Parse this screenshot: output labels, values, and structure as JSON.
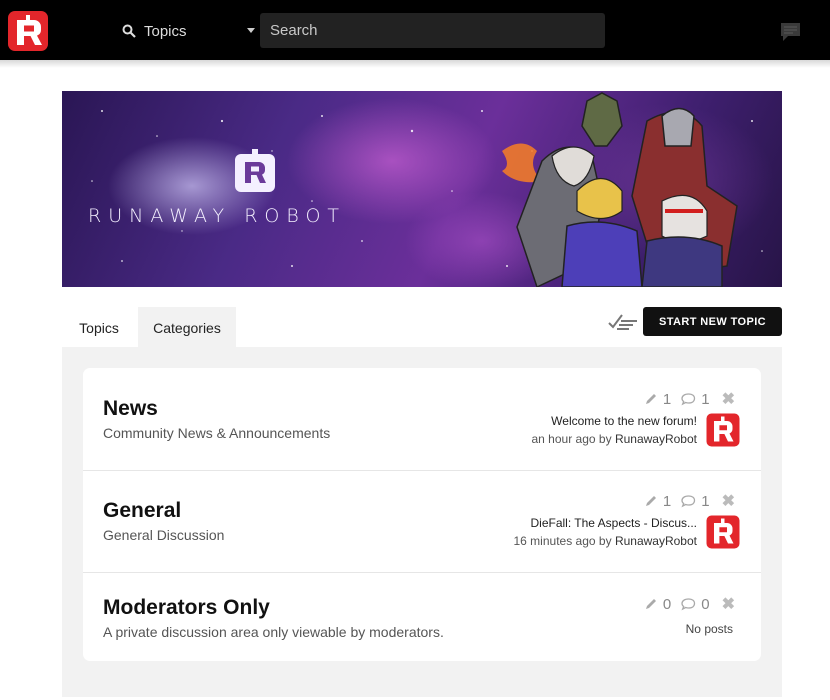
{
  "header": {
    "topics_label": "Topics",
    "search_placeholder": "Search"
  },
  "banner": {
    "text": "RUNAWAY ROBOT"
  },
  "tabs": [
    {
      "label": "Topics"
    },
    {
      "label": "Categories"
    }
  ],
  "actions": {
    "new_topic_label": "START NEW TOPIC"
  },
  "categories": [
    {
      "title": "News",
      "description": "Community News & Announcements",
      "topic_count": "1",
      "post_count": "1",
      "last_post": {
        "title": "Welcome to the new forum!",
        "time": "an hour ago",
        "by": "by",
        "author": "RunawayRobot"
      }
    },
    {
      "title": "General",
      "description": "General Discussion",
      "topic_count": "1",
      "post_count": "1",
      "last_post": {
        "title": "DieFall: The Aspects - Discus...",
        "time": "16 minutes ago",
        "by": "by",
        "author": "RunawayRobot"
      }
    },
    {
      "title": "Moderators Only",
      "description": "A private discussion area only viewable by moderators.",
      "topic_count": "0",
      "post_count": "0",
      "no_posts": "No posts"
    }
  ],
  "colors": {
    "brand_red": "#e3262b",
    "topbar": "#000000",
    "button_dark": "#111111"
  }
}
